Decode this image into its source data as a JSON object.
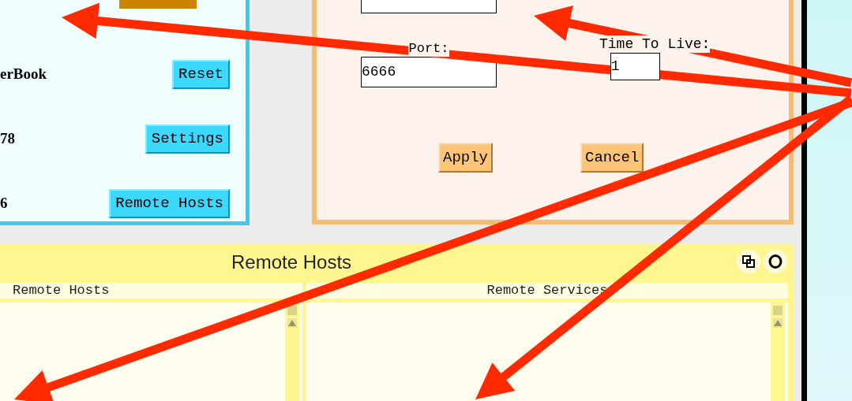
{
  "device_panel": {
    "rows": [
      {
        "value": "erBook",
        "button": "Reset"
      },
      {
        "value": "78",
        "button": "Settings"
      },
      {
        "value": "6",
        "button": "Remote Hosts"
      }
    ]
  },
  "settings_panel": {
    "port": {
      "label": "Port:",
      "value": "6666"
    },
    "ttl": {
      "label": "Time To Live:",
      "value": "1"
    },
    "buttons": [
      "Apply",
      "Cancel"
    ]
  },
  "remote_hosts_window": {
    "title": "Remote Hosts",
    "columns": [
      "Remote Hosts",
      "Remote Services"
    ]
  }
}
